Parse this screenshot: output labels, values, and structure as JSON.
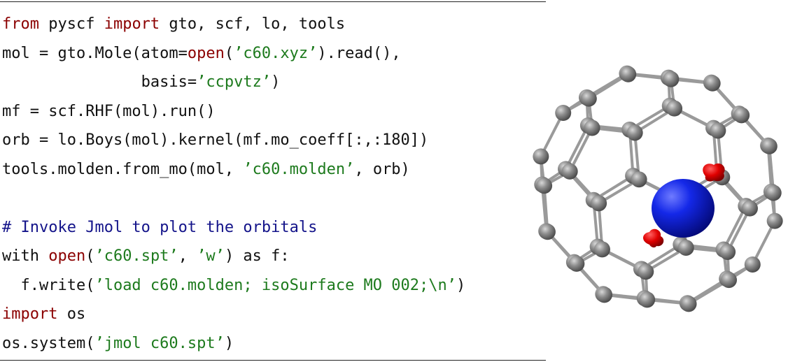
{
  "listing": {
    "lines": [
      [
        {
          "t": "kw",
          "v": "from"
        },
        {
          "t": "txt",
          "v": " pyscf "
        },
        {
          "t": "kw",
          "v": "import"
        },
        {
          "t": "txt",
          "v": " gto, scf, lo, tools"
        }
      ],
      [
        {
          "t": "txt",
          "v": "mol = gto.Mole(atom="
        },
        {
          "t": "kw",
          "v": "open"
        },
        {
          "t": "txt",
          "v": "("
        },
        {
          "t": "str",
          "v": "’c60.xyz’"
        },
        {
          "t": "txt",
          "v": ").read(),"
        }
      ],
      [
        {
          "t": "txt",
          "v": "               basis="
        },
        {
          "t": "str",
          "v": "’ccpvtz’"
        },
        {
          "t": "txt",
          "v": ")"
        }
      ],
      [
        {
          "t": "txt",
          "v": "mf = scf.RHF(mol).run()"
        }
      ],
      [
        {
          "t": "txt",
          "v": "orb = lo.Boys(mol).kernel(mf.mo_coeff[:,:180])"
        }
      ],
      [
        {
          "t": "txt",
          "v": "tools.molden.from_mo(mol, "
        },
        {
          "t": "str",
          "v": "’c60.molden’"
        },
        {
          "t": "txt",
          "v": ", orb)"
        }
      ],
      [],
      [
        {
          "t": "com",
          "v": "# Invoke Jmol to plot the orbitals"
        }
      ],
      [
        {
          "t": "txt",
          "v": "with "
        },
        {
          "t": "kw",
          "v": "open"
        },
        {
          "t": "txt",
          "v": "("
        },
        {
          "t": "str",
          "v": "’c60.spt’"
        },
        {
          "t": "txt",
          "v": ", "
        },
        {
          "t": "str",
          "v": "’w’"
        },
        {
          "t": "txt",
          "v": ") as f:"
        }
      ],
      [
        {
          "t": "txt",
          "v": "  f.write("
        },
        {
          "t": "str",
          "v": "’load c60.molden; isoSurface MO 002;\\n’"
        },
        {
          "t": "txt",
          "v": ")"
        }
      ],
      [
        {
          "t": "kw",
          "v": "import"
        },
        {
          "t": "txt",
          "v": " os"
        }
      ],
      [
        {
          "t": "txt",
          "v": "os.system("
        },
        {
          "t": "str",
          "v": "’jmol c60.spt’"
        },
        {
          "t": "txt",
          "v": ")"
        }
      ]
    ]
  },
  "figure": {
    "atom_color": "#8a8a8a",
    "bond_color": "#9a9a9a",
    "lobe_major_color": "#0a1fe0",
    "lobe_minor_color": "#e00000"
  }
}
